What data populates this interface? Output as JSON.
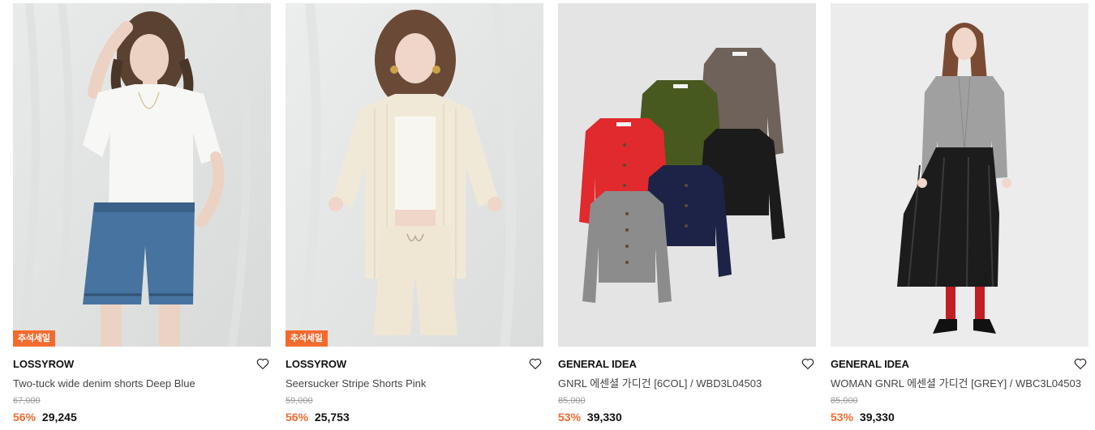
{
  "products": [
    {
      "badge": "추석세일",
      "brand": "LOSSYROW",
      "name": "Two-tuck wide denim shorts Deep Blue",
      "original_price": "67,000",
      "discount": "56%",
      "sale_price": "29,245",
      "image_icon": "photo-model-white-tee-denim-shorts"
    },
    {
      "badge": "추석세일",
      "brand": "LOSSYROW",
      "name": "Seersucker Stripe Shorts Pink",
      "original_price": "59,000",
      "discount": "56%",
      "sale_price": "25,753",
      "image_icon": "photo-model-stripe-shirt-shorts"
    },
    {
      "badge": "",
      "brand": "GENERAL IDEA",
      "name": "GNRL 에센셜 가디건 [6COL] / WBD3L04503",
      "original_price": "85,000",
      "discount": "53%",
      "sale_price": "39,330",
      "image_icon": "photo-six-cardigans"
    },
    {
      "badge": "",
      "brand": "GENERAL IDEA",
      "name": "WOMAN GNRL 에센셜 가디건 [GREY] / WBC3L04503",
      "original_price": "85,000",
      "discount": "53%",
      "sale_price": "39,330",
      "image_icon": "photo-model-grey-cardigan-leather-skirt"
    }
  ],
  "colors": {
    "accent": "#f26a2e",
    "text": "#111111",
    "muted": "#9a9a9a"
  }
}
